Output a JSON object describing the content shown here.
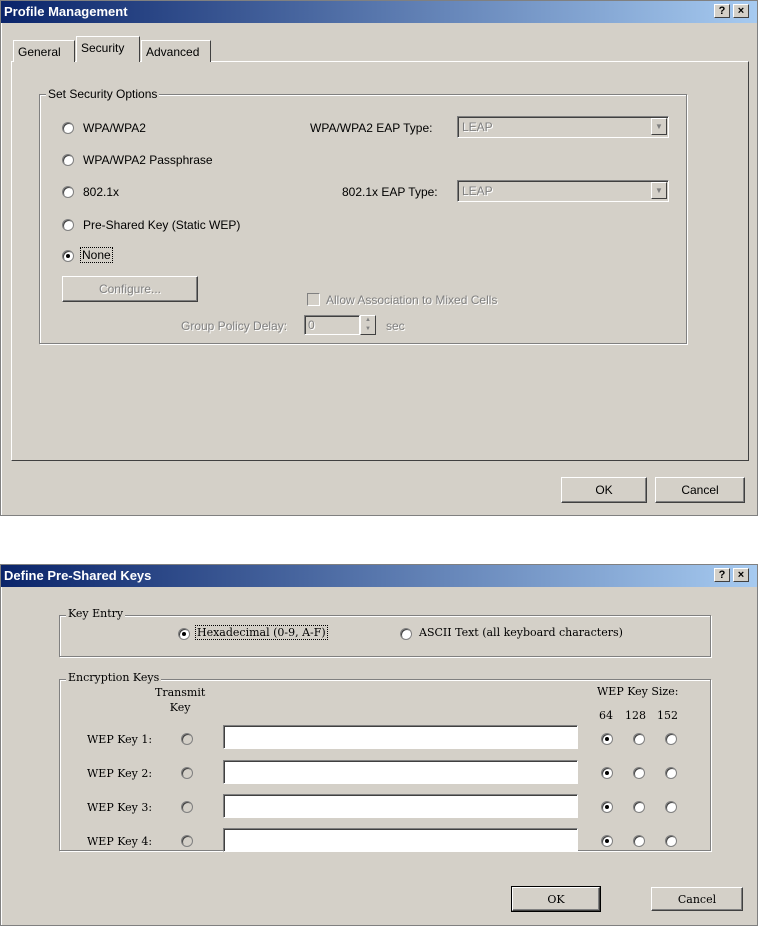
{
  "profile_window": {
    "title": "Profile Management",
    "help_button": "?",
    "close_button": "×",
    "tabs": [
      {
        "label": "General",
        "selected": false
      },
      {
        "label": "Security",
        "selected": true
      },
      {
        "label": "Advanced",
        "selected": false
      }
    ],
    "group_title": "Set Security Options",
    "options": [
      {
        "label": "WPA/WPA2",
        "checked": false
      },
      {
        "label": "WPA/WPA2 Passphrase",
        "checked": false
      },
      {
        "label": "802.1x",
        "checked": false
      },
      {
        "label": "Pre-Shared Key (Static WEP)",
        "checked": false
      },
      {
        "label": "None",
        "checked": true
      }
    ],
    "wpa_eap_label": "WPA/WPA2 EAP Type:",
    "wpa_eap_value": "LEAP",
    "dot1x_eap_label": "802.1x EAP Type:",
    "dot1x_eap_value": "LEAP",
    "configure_label": "Configure...",
    "allow_mixed_label": "Allow Association to Mixed Cells",
    "group_policy_label": "Group Policy Delay:",
    "group_policy_value": "0",
    "group_policy_unit": "sec",
    "ok_label": "OK",
    "cancel_label": "Cancel"
  },
  "keys_window": {
    "title": "Define Pre-Shared Keys",
    "help_button": "?",
    "close_button": "×",
    "key_entry_title": "Key Entry",
    "hex_label": "Hexadecimal (0-9, A-F)",
    "ascii_label": "ASCII Text (all keyboard characters)",
    "encryption_title": "Encryption Keys",
    "transmit_label_1": "Transmit",
    "transmit_label_2": "Key",
    "wep_size_label": "WEP Key Size:",
    "sizes": [
      "64",
      "128",
      "152"
    ],
    "keys": [
      {
        "label": "WEP Key 1:",
        "value": ""
      },
      {
        "label": "WEP Key 2:",
        "value": ""
      },
      {
        "label": "WEP Key 3:",
        "value": ""
      },
      {
        "label": "WEP Key 4:",
        "value": ""
      }
    ],
    "ok_label": "OK",
    "cancel_label": "Cancel"
  }
}
